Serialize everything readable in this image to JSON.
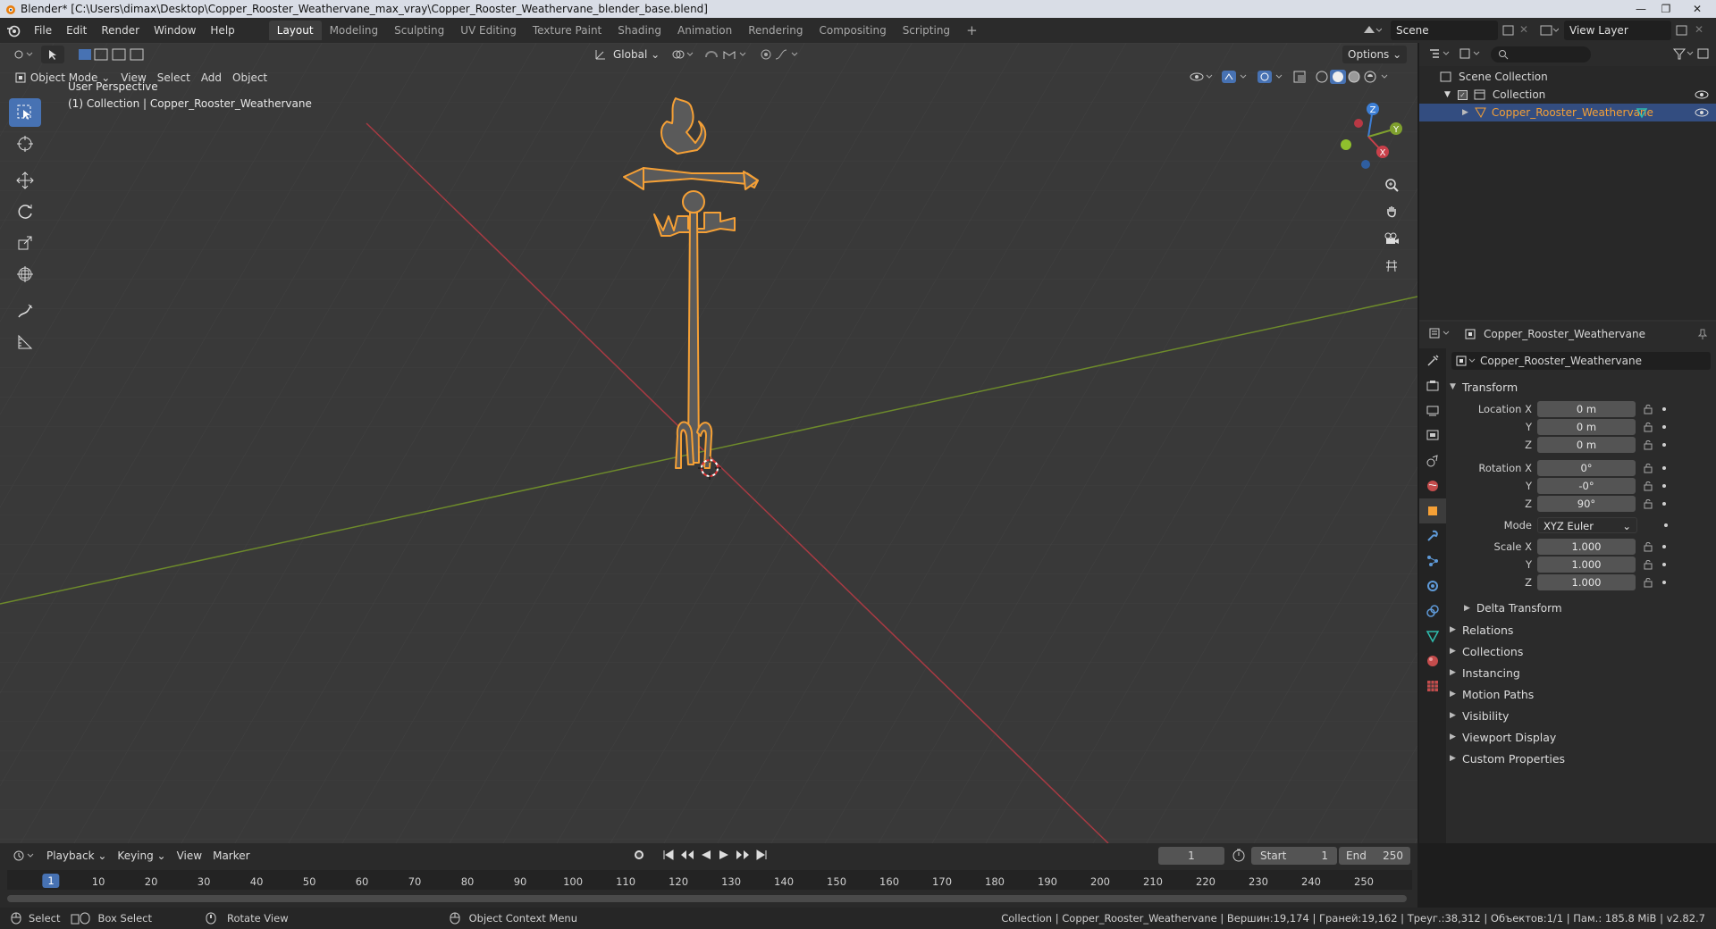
{
  "titlebar": {
    "title": "Blender* [C:\\Users\\dimax\\Desktop\\Copper_Rooster_Weathervane_max_vray\\Copper_Rooster_Weathervane_blender_base.blend]",
    "minimize": "—",
    "maximize": "❐",
    "close": "✕"
  },
  "menu": [
    "File",
    "Edit",
    "Render",
    "Window",
    "Help"
  ],
  "workspaces": [
    "Layout",
    "Modeling",
    "Sculpting",
    "UV Editing",
    "Texture Paint",
    "Shading",
    "Animation",
    "Rendering",
    "Compositing",
    "Scripting"
  ],
  "active_workspace": "Layout",
  "add_workspace": "+",
  "scene": {
    "label": "Scene",
    "view_layer": "View Layer"
  },
  "viewport": {
    "transform_orientation": "Global",
    "options": "Options",
    "mode": "Object Mode",
    "header_menu": [
      "View",
      "Select",
      "Add",
      "Object"
    ],
    "perspective_label": "User Perspective",
    "collection_label": "(1) Collection | Copper_Rooster_Weathervane",
    "gizmo": {
      "x": "X",
      "y": "Y",
      "z": "Z"
    }
  },
  "outliner": {
    "scene_collection": "Scene Collection",
    "collection": "Collection",
    "object": "Copper_Rooster_Weathervane"
  },
  "properties": {
    "header_object": "Copper_Rooster_Weathervane",
    "object_name": "Copper_Rooster_Weathervane",
    "transform_title": "Transform",
    "location_label": "Location X",
    "y_label": "Y",
    "z_label": "Z",
    "location": {
      "x": "0 m",
      "y": "0 m",
      "z": "0 m"
    },
    "rotation_label": "Rotation X",
    "rotation": {
      "x": "0°",
      "y": "-0°",
      "z": "90°"
    },
    "mode_label": "Mode",
    "mode_value": "XYZ Euler",
    "scale_label": "Scale X",
    "scale": {
      "x": "1.000",
      "y": "1.000",
      "z": "1.000"
    },
    "delta_transform": "Delta Transform",
    "sections": [
      "Relations",
      "Collections",
      "Instancing",
      "Motion Paths",
      "Visibility",
      "Viewport Display",
      "Custom Properties"
    ]
  },
  "timeline": {
    "menus": [
      "Playback",
      "Keying",
      "View",
      "Marker"
    ],
    "current_frame": "1",
    "start_label": "Start",
    "start_value": "1",
    "end_label": "End",
    "end_value": "250",
    "ticks": [
      "1",
      "10",
      "20",
      "30",
      "40",
      "50",
      "60",
      "70",
      "80",
      "90",
      "100",
      "110",
      "120",
      "130",
      "140",
      "150",
      "160",
      "170",
      "180",
      "190",
      "200",
      "210",
      "220",
      "230",
      "240",
      "250"
    ]
  },
  "statusbar": {
    "select": "Select",
    "box_select": "Box Select",
    "rotate_view": "Rotate View",
    "context_menu": "Object Context Menu",
    "stats": "Collection | Copper_Rooster_Weathervane | Вершин:19,174 | Граней:19,162 | Треуг.:38,312 | Объектов:1/1 | Пам.: 185.8 MiB | v2.82.7"
  },
  "colors": {
    "accent": "#4772b3",
    "selection": "#f5a036",
    "x_axis": "#c9404a",
    "y_axis": "#7fa02e",
    "z_axis": "#3d7fd6"
  }
}
